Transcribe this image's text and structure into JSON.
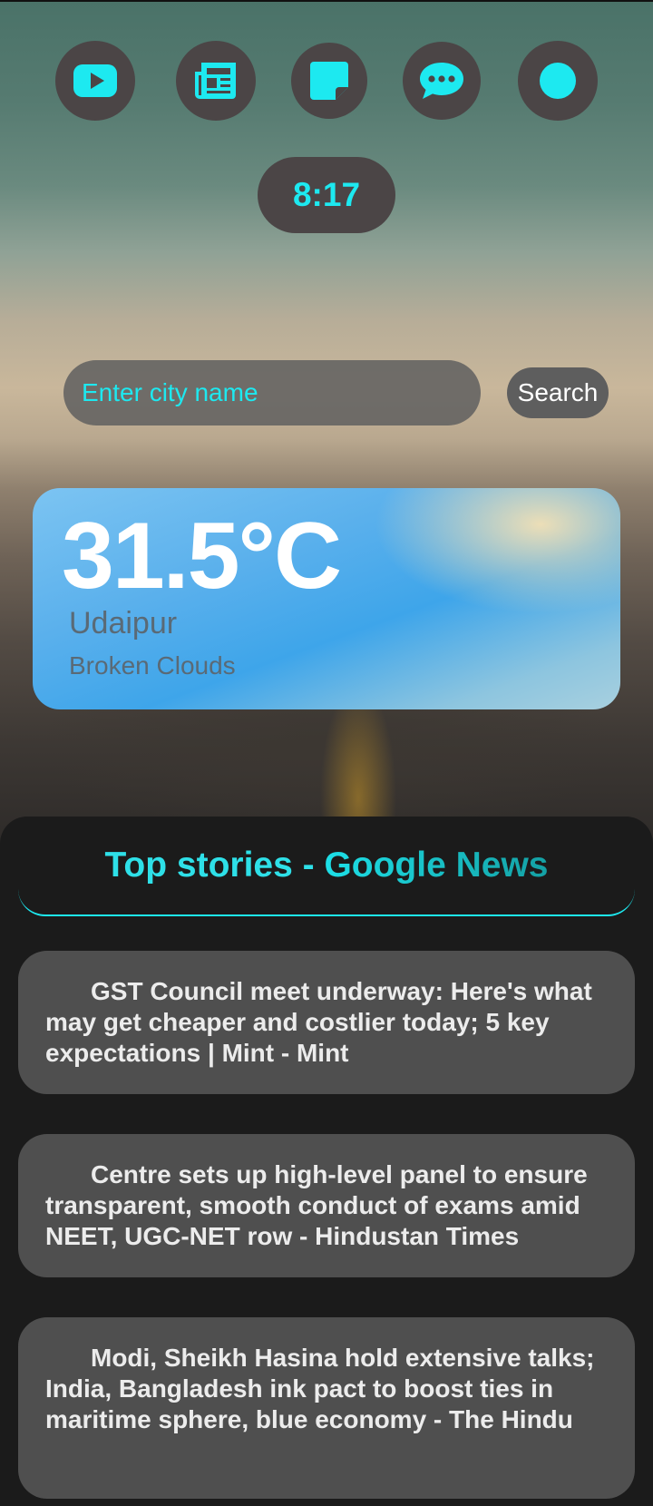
{
  "quick_links": [
    {
      "name": "youtube-icon"
    },
    {
      "name": "newspaper-icon"
    },
    {
      "name": "sticky-note-icon"
    },
    {
      "name": "chat-icon"
    },
    {
      "name": "circle-icon"
    }
  ],
  "clock": {
    "time": "8:17"
  },
  "search": {
    "placeholder": "Enter city name",
    "value": "",
    "button_label": "Search"
  },
  "weather": {
    "temperature": "31.5°C",
    "city": "Udaipur",
    "condition": "Broken Clouds"
  },
  "news": {
    "title_part1": "Top stories - ",
    "title_part2": "Google News",
    "items": [
      {
        "headline": "GST Council meet underway: Here's what may get cheaper and costlier today; 5 key expectations | Mint - Mint"
      },
      {
        "headline": "Centre sets up high-level panel to ensure transparent, smooth conduct of exams amid NEET, UGC-NET row - Hindustan Times"
      },
      {
        "headline": "Modi, Sheikh Hasina hold extensive talks; India, Bangladesh ink pact to boost ties in maritime sphere, blue economy - The Hindu"
      }
    ]
  },
  "colors": {
    "accent": "#1de9f0",
    "button_bg": "#4b4546",
    "panel_bg": "#1b1b1b",
    "card_bg": "#4f4f4f"
  }
}
